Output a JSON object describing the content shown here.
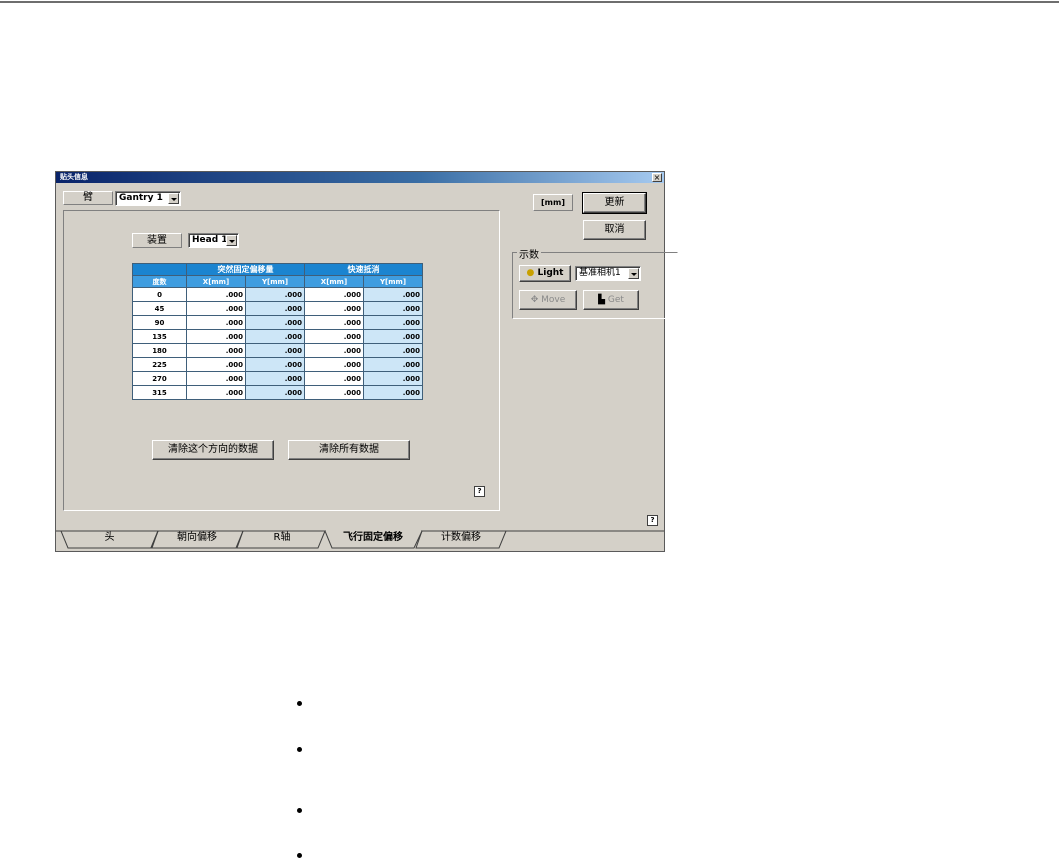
{
  "window": {
    "title": "贴头信息",
    "close_glyph": "×"
  },
  "arm": {
    "label": "臂",
    "value": "Gantry 1"
  },
  "device": {
    "label": "装置",
    "value": "Head 1"
  },
  "unit_label": "[mm]",
  "buttons": {
    "update": "更新",
    "cancel": "取消",
    "clear_direction": "清除这个方向的数据",
    "clear_all": "清除所有数据",
    "light": "Light",
    "move": "Move",
    "get": "Get",
    "help": "?"
  },
  "teach": {
    "legend": "示数",
    "camera_value": "基准相机1"
  },
  "table": {
    "group_headers": [
      "突然固定偏移量",
      "快速抵消"
    ],
    "degree_header": "度数",
    "sub_headers": [
      "X[mm]",
      "Y[mm]",
      "X[mm]",
      "Y[mm]"
    ],
    "rows": [
      {
        "deg": "0",
        "v": [
          ".000",
          ".000",
          ".000",
          ".000"
        ]
      },
      {
        "deg": "45",
        "v": [
          ".000",
          ".000",
          ".000",
          ".000"
        ]
      },
      {
        "deg": "90",
        "v": [
          ".000",
          ".000",
          ".000",
          ".000"
        ]
      },
      {
        "deg": "135",
        "v": [
          ".000",
          ".000",
          ".000",
          ".000"
        ]
      },
      {
        "deg": "180",
        "v": [
          ".000",
          ".000",
          ".000",
          ".000"
        ]
      },
      {
        "deg": "225",
        "v": [
          ".000",
          ".000",
          ".000",
          ".000"
        ]
      },
      {
        "deg": "270",
        "v": [
          ".000",
          ".000",
          ".000",
          ".000"
        ]
      },
      {
        "deg": "315",
        "v": [
          ".000",
          ".000",
          ".000",
          ".000"
        ]
      }
    ]
  },
  "tabs": [
    {
      "label": "头",
      "active": false
    },
    {
      "label": "朝向偏移",
      "active": false
    },
    {
      "label": "R轴",
      "active": false
    },
    {
      "label": "飞行固定偏移",
      "active": true
    },
    {
      "label": "计数偏移",
      "active": false
    }
  ]
}
